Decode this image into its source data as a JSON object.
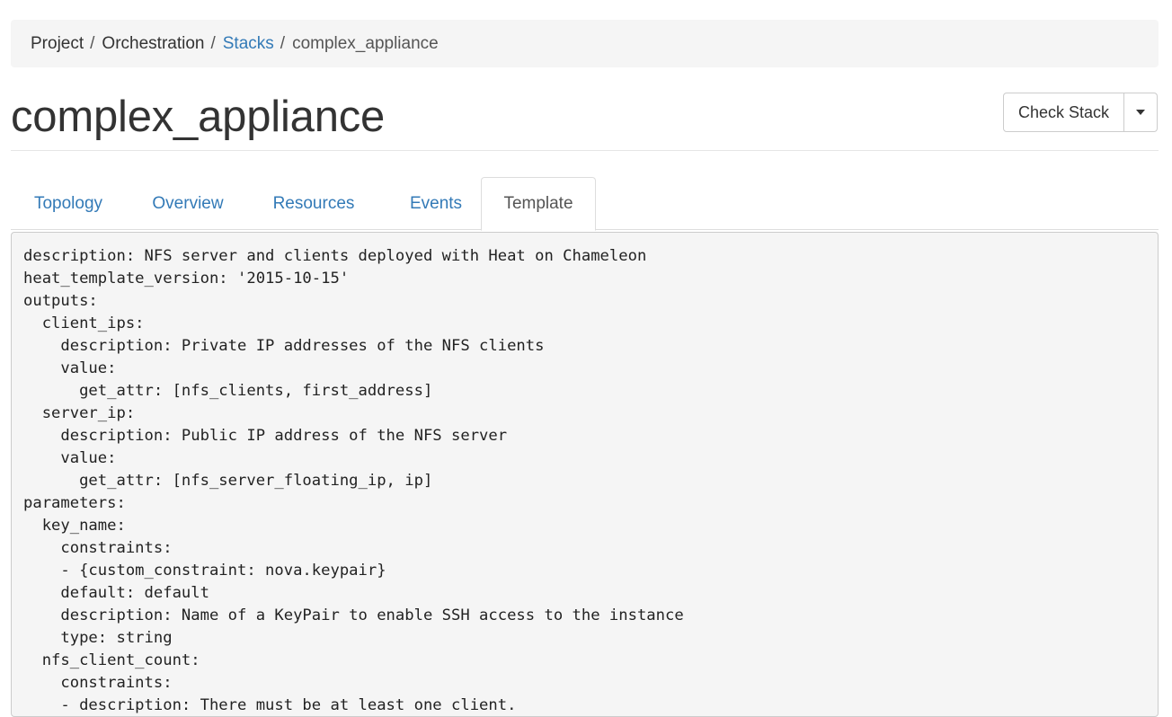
{
  "breadcrumb": {
    "items": [
      {
        "label": "Project"
      },
      {
        "label": "Orchestration"
      },
      {
        "label": "Stacks"
      },
      {
        "label": "complex_appliance"
      }
    ],
    "separator": "/"
  },
  "page": {
    "title": "complex_appliance"
  },
  "actions": {
    "check_stack_label": "Check Stack"
  },
  "tabs": [
    {
      "label": "Topology"
    },
    {
      "label": "Overview"
    },
    {
      "label": "Resources"
    },
    {
      "label": "Events"
    },
    {
      "label": "Template",
      "active": true
    }
  ],
  "template": {
    "lines": [
      "description: NFS server and clients deployed with Heat on Chameleon",
      "heat_template_version: '2015-10-15'",
      "outputs:",
      "  client_ips:",
      "    description: Private IP addresses of the NFS clients",
      "    value:",
      "      get_attr: [nfs_clients, first_address]",
      "  server_ip:",
      "    description: Public IP address of the NFS server",
      "    value:",
      "      get_attr: [nfs_server_floating_ip, ip]",
      "parameters:",
      "  key_name:",
      "    constraints:",
      "    - {custom_constraint: nova.keypair}",
      "    default: default",
      "    description: Name of a KeyPair to enable SSH access to the instance",
      "    type: string",
      "  nfs_client_count:",
      "    constraints:",
      "    - description: There must be at least one client."
    ]
  },
  "colors": {
    "link": "#337ab7",
    "panel_bg": "#f5f5f5",
    "text": "#333333"
  }
}
